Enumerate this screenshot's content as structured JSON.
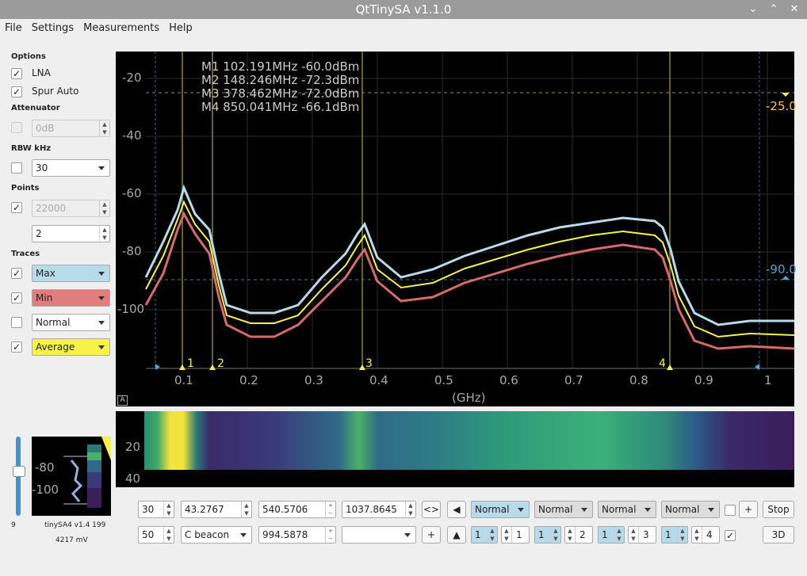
{
  "window": {
    "title": "QtTinySA v1.1.0"
  },
  "menu": [
    "File",
    "Settings",
    "Measurements",
    "Help"
  ],
  "options": {
    "section_options": "Options",
    "lna_label": "LNA",
    "spur_label": "Spur Auto",
    "section_attenuator": "Attenuator",
    "attenuator_value": "0dB",
    "section_rbw": "RBW kHz",
    "rbw_value": "30",
    "section_points": "Points",
    "points_value": "22000",
    "points_avg": "2",
    "section_traces": "Traces",
    "traces": [
      {
        "label": "Max",
        "color": "#b7dbea",
        "checked": true
      },
      {
        "label": "Min",
        "color": "#e27d7d",
        "checked": true
      },
      {
        "label": "Normal",
        "color": "#ffffff",
        "checked": false
      },
      {
        "label": "Average",
        "color": "#f6f24a",
        "checked": true
      }
    ]
  },
  "plot": {
    "markers_text": [
      "M1 102.191MHz -60.0dBm",
      "M2 148.246MHz -72.3dBm",
      "M3 378.462MHz -72.0dBm",
      "M4 850.041MHz -66.1dBm"
    ],
    "marker_ids": [
      "1",
      "2",
      "3",
      "4"
    ],
    "y_ticks": [
      "-20",
      "-40",
      "-60",
      "-80",
      "-100"
    ],
    "x_ticks": [
      "0.1",
      "0.2",
      "0.3",
      "0.4",
      "0.5",
      "0.6",
      "0.7",
      "0.8",
      "0.9",
      "1"
    ],
    "x_unit": "(GHz)",
    "line_upper": "-25.0",
    "line_lower": "-90.0",
    "auto_button": "A"
  },
  "waterfall": {
    "y_ticks": [
      "20",
      "40"
    ]
  },
  "device": {
    "name": "tinySA4 v1.4 199",
    "voltage": "4217 mV",
    "slider_value": "9",
    "mini_ticks": [
      "-80",
      "-100"
    ]
  },
  "controls": {
    "row1": {
      "a": "30",
      "b": "43.2767",
      "c": "540.5706",
      "d": "1037.8645",
      "swap": "<>",
      "left": "◀",
      "modes": [
        "Normal",
        "Normal",
        "Normal",
        "Normal"
      ],
      "plus": "+",
      "stop": "Stop"
    },
    "row2": {
      "a": "50",
      "preset": "C beacon",
      "c": "994.5878",
      "d": "",
      "plus": "+",
      "up": "▲",
      "marker_groups": [
        {
          "v": "1",
          "n": "1"
        },
        {
          "v": "1",
          "n": "2"
        },
        {
          "v": "1",
          "n": "3"
        },
        {
          "v": "1",
          "n": "4"
        }
      ],
      "threeD": "3D"
    }
  }
}
